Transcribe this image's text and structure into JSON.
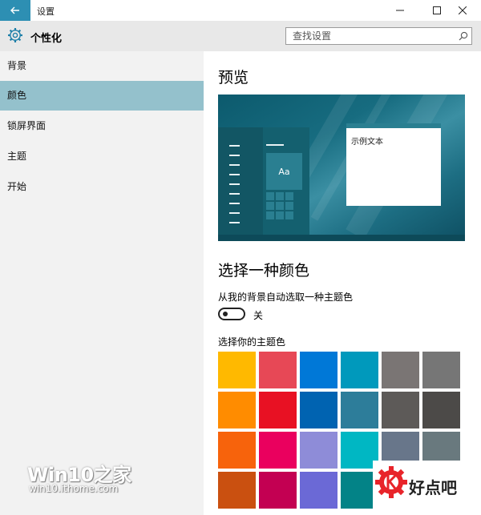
{
  "window": {
    "title": "设置"
  },
  "header": {
    "title": "个性化",
    "search_placeholder": "查找设置"
  },
  "sidebar": {
    "items": [
      {
        "label": "背景"
      },
      {
        "label": "颜色"
      },
      {
        "label": "锁屏界面"
      },
      {
        "label": "主题"
      },
      {
        "label": "开始"
      }
    ]
  },
  "content": {
    "preview_heading": "预览",
    "preview_sample_text": "示例文本",
    "preview_tile_text": "Aa",
    "choose_heading": "选择一种颜色",
    "auto_pick_label": "从我的背景自动选取一种主题色",
    "auto_pick_state": "关",
    "accent_label": "选择你的主题色",
    "swatches": [
      [
        "#ffb900",
        "#e74856",
        "#0078d7",
        "#0099bc",
        "#7a7574",
        "#767676"
      ],
      [
        "#ff8c00",
        "#e81123",
        "#0063b1",
        "#2d7d9a",
        "#5d5a58",
        "#4c4a48"
      ],
      [
        "#f7630c",
        "#ea005e",
        "#8e8cd8",
        "#00b7c3",
        "#68768a",
        "#69797e"
      ],
      [
        "#ca5010",
        "#c30052",
        "#6b69d6",
        "#038387",
        "#515c6b",
        "#4a5459"
      ]
    ]
  },
  "watermark": {
    "logo_text": "Win10之家",
    "url": "win10.ithome.com",
    "badge_text": "好点吧"
  },
  "colors": {
    "accent": "#2d8fb3",
    "sidebar_active": "#94c1cc"
  }
}
